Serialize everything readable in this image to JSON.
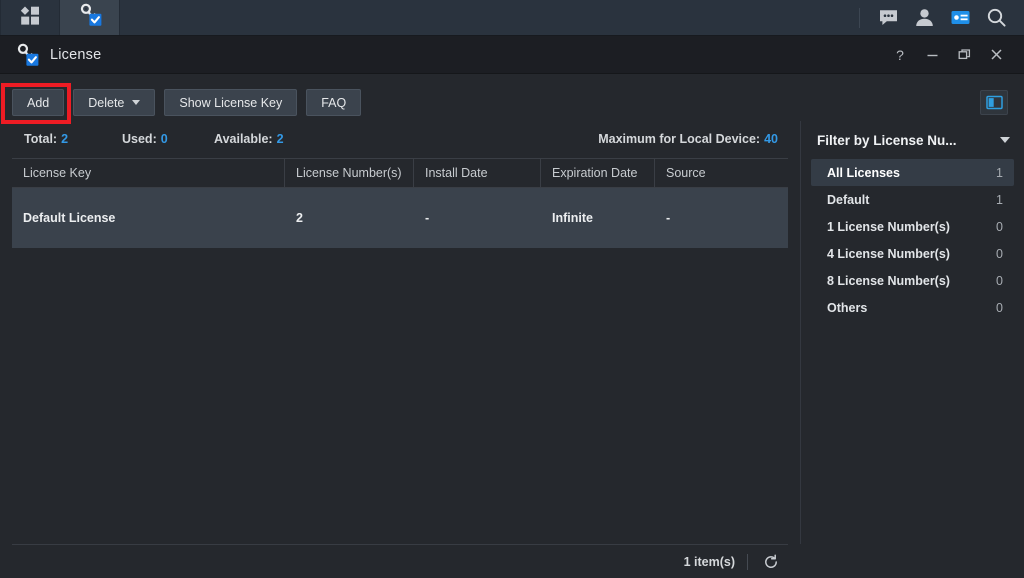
{
  "taskbar": {
    "apps_icon": "grid-apps-icon",
    "license_icon": "license-key-icon",
    "right_icons": [
      {
        "name": "chat-icon",
        "label": "Notifications"
      },
      {
        "name": "user-icon",
        "label": "User"
      },
      {
        "name": "widget-icon",
        "label": "Widgets"
      },
      {
        "name": "search-icon",
        "label": "Search"
      }
    ]
  },
  "window": {
    "title": "License",
    "icon": "license-key-icon",
    "controls": {
      "help": "?",
      "minimize": "–",
      "maximize": "❐",
      "close": "✕"
    }
  },
  "toolbar": {
    "add_label": "Add",
    "delete_label": "Delete",
    "show_key_label": "Show License Key",
    "faq_label": "FAQ",
    "panel_toggle_icon": "side-panel-toggle-icon"
  },
  "stats": {
    "total_label": "Total:",
    "total_value": "2",
    "used_label": "Used:",
    "used_value": "0",
    "available_label": "Available:",
    "available_value": "2",
    "maximum_label": "Maximum for Local Device:",
    "maximum_value": "40"
  },
  "table": {
    "columns": [
      "License Key",
      "License Number(s)",
      "Install Date",
      "Expiration Date",
      "Source"
    ],
    "rows": [
      {
        "license_key": "Default License",
        "license_numbers": "2",
        "install_date": "-",
        "expiration_date": "Infinite",
        "source": "-"
      }
    ]
  },
  "sidebar": {
    "title": "Filter by License Nu...",
    "caret_icon": "chevron-down-icon",
    "items": [
      {
        "label": "All Licenses",
        "count": "1",
        "selected": true
      },
      {
        "label": "Default",
        "count": "1",
        "selected": false
      },
      {
        "label": "1 License Number(s)",
        "count": "0",
        "selected": false
      },
      {
        "label": "4 License Number(s)",
        "count": "0",
        "selected": false
      },
      {
        "label": "8 License Number(s)",
        "count": "0",
        "selected": false
      },
      {
        "label": "Others",
        "count": "0",
        "selected": false
      }
    ]
  },
  "footer": {
    "item_count": "1 item(s)",
    "refresh_icon": "refresh-icon"
  },
  "annotation": {
    "target": "Add",
    "color": "#ee1c24"
  },
  "colors": {
    "accent_blue": "#3399e6",
    "taskbar_bg": "#2a333e",
    "window_bg": "#25282d",
    "titlebar_bg": "#1c1e23",
    "row_selected": "#3a424c",
    "annotation_red": "#ee1c24"
  }
}
